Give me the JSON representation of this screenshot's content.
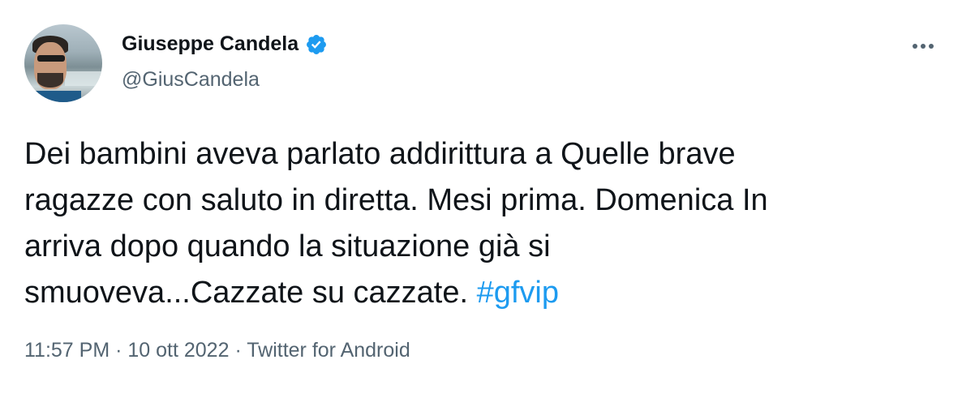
{
  "author": {
    "name": "Giuseppe Candela",
    "handle": "@GiusCandela",
    "verified_color": "#1d9bf0"
  },
  "tweet": {
    "lines": [
      "Dei bambini aveva parlato addirittura a Quelle brave",
      "ragazze con saluto in diretta. Mesi prima. Domenica In",
      "arriva dopo quando la situazione già si",
      "smuoveva...Cazzate su cazzate. "
    ],
    "hashtag": "#gfvip"
  },
  "meta": {
    "time": "11:57 PM",
    "separator": " · ",
    "date": "10 ott 2022",
    "source": "Twitter for Android"
  },
  "colors": {
    "text": "#0f1419",
    "secondary": "#536471",
    "link": "#1d9bf0"
  },
  "icons": {
    "verified": "verified-badge-icon",
    "more": "more-options-icon"
  }
}
